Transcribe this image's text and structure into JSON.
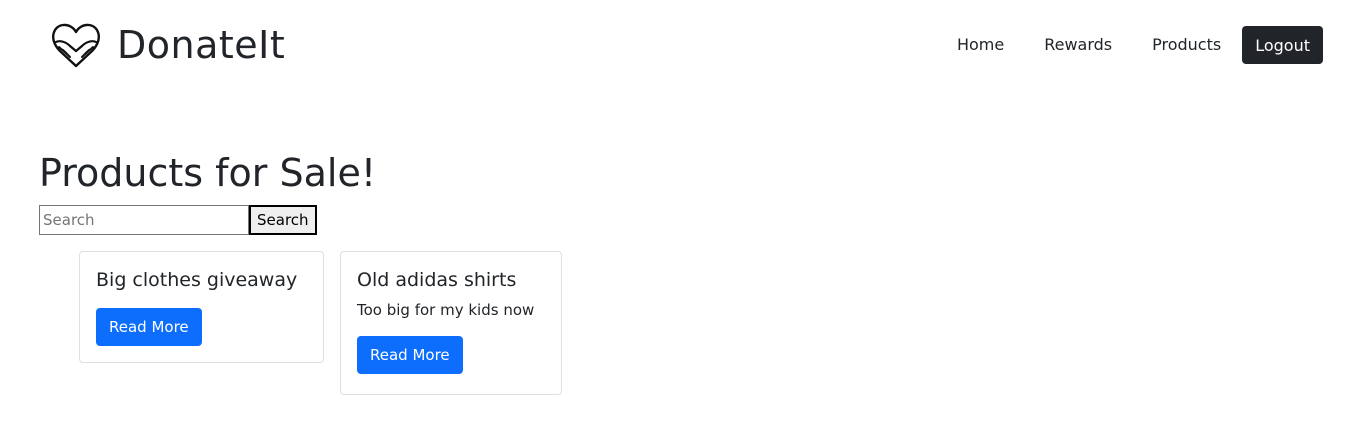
{
  "navbar": {
    "brand_name": "DonateIt",
    "logo_icon": "heart-hands-icon",
    "links": [
      {
        "label": "Home"
      },
      {
        "label": "Rewards"
      },
      {
        "label": "Products"
      }
    ],
    "logout_label": "Logout"
  },
  "main": {
    "title": "Products for Sale!",
    "search": {
      "placeholder": "Search",
      "value": "",
      "button_label": "Search"
    },
    "products": [
      {
        "title": "Big clothes giveaway",
        "description": "",
        "button_label": "Read More"
      },
      {
        "title": "Old adidas shirts",
        "description": "Too big for my kids now",
        "button_label": "Read More"
      }
    ]
  },
  "colors": {
    "primary": "#0d6efd",
    "dark": "#212529",
    "card_border": "#dfdfdf"
  }
}
